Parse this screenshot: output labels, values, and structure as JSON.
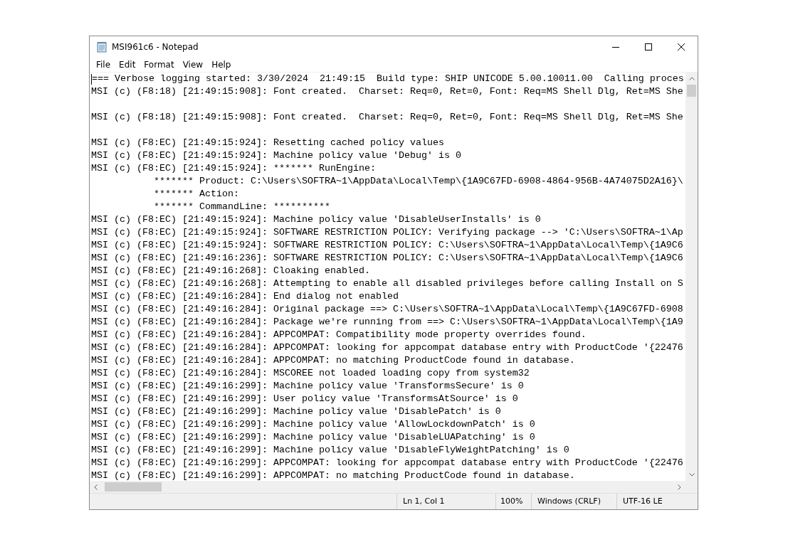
{
  "window": {
    "title": "MSI961c6 - Notepad"
  },
  "menu": [
    "File",
    "Edit",
    "Format",
    "View",
    "Help"
  ],
  "lines": [
    {
      "kind": "text",
      "text": "=== Verbose logging started: 3/30/2024  21:49:15  Build type: SHIP UNICODE 5.00.10011.00  Calling proces",
      "caret": true
    },
    {
      "kind": "text",
      "text": "MSI (c) (F8:18) [21:49:15:908]: Font created.  Charset: Req=0, Ret=0, Font: Req=MS Shell Dlg, Ret=MS She",
      "caret": false
    },
    {
      "kind": "blank"
    },
    {
      "kind": "text",
      "text": "MSI (c) (F8:18) [21:49:15:908]: Font created.  Charset: Req=0, Ret=0, Font: Req=MS Shell Dlg, Ret=MS She",
      "caret": false
    },
    {
      "kind": "blank"
    },
    {
      "kind": "text",
      "text": "MSI (c) (F8:EC) [21:49:15:924]: Resetting cached policy values",
      "caret": false
    },
    {
      "kind": "text",
      "text": "MSI (c) (F8:EC) [21:49:15:924]: Machine policy value 'Debug' is 0",
      "caret": false
    },
    {
      "kind": "text",
      "text": "MSI (c) (F8:EC) [21:49:15:924]: ******* RunEngine:",
      "caret": false
    },
    {
      "kind": "text",
      "text": "           ******* Product: C:\\Users\\SOFTRA~1\\AppData\\Local\\Temp\\{1A9C67FD-6908-4864-956B-4A74075D2A16}\\",
      "caret": false
    },
    {
      "kind": "text",
      "text": "           ******* Action: ",
      "caret": false
    },
    {
      "kind": "text",
      "text": "           ******* CommandLine: **********",
      "caret": false
    },
    {
      "kind": "text",
      "text": "MSI (c) (F8:EC) [21:49:15:924]: Machine policy value 'DisableUserInstalls' is 0",
      "caret": false
    },
    {
      "kind": "text",
      "text": "MSI (c) (F8:EC) [21:49:15:924]: SOFTWARE RESTRICTION POLICY: Verifying package --> 'C:\\Users\\SOFTRA~1\\Ap",
      "caret": false
    },
    {
      "kind": "text",
      "text": "MSI (c) (F8:EC) [21:49:15:924]: SOFTWARE RESTRICTION POLICY: C:\\Users\\SOFTRA~1\\AppData\\Local\\Temp\\{1A9C6",
      "caret": false
    },
    {
      "kind": "text",
      "text": "MSI (c) (F8:EC) [21:49:16:236]: SOFTWARE RESTRICTION POLICY: C:\\Users\\SOFTRA~1\\AppData\\Local\\Temp\\{1A9C6",
      "caret": false
    },
    {
      "kind": "text",
      "text": "MSI (c) (F8:EC) [21:49:16:268]: Cloaking enabled.",
      "caret": false
    },
    {
      "kind": "text",
      "text": "MSI (c) (F8:EC) [21:49:16:268]: Attempting to enable all disabled privileges before calling Install on S",
      "caret": false
    },
    {
      "kind": "text",
      "text": "MSI (c) (F8:EC) [21:49:16:284]: End dialog not enabled",
      "caret": false
    },
    {
      "kind": "text",
      "text": "MSI (c) (F8:EC) [21:49:16:284]: Original package ==> C:\\Users\\SOFTRA~1\\AppData\\Local\\Temp\\{1A9C67FD-6908",
      "caret": false
    },
    {
      "kind": "text",
      "text": "MSI (c) (F8:EC) [21:49:16:284]: Package we're running from ==> C:\\Users\\SOFTRA~1\\AppData\\Local\\Temp\\{1A9",
      "caret": false
    },
    {
      "kind": "text",
      "text": "MSI (c) (F8:EC) [21:49:16:284]: APPCOMPAT: Compatibility mode property overrides found.",
      "caret": false
    },
    {
      "kind": "text",
      "text": "MSI (c) (F8:EC) [21:49:16:284]: APPCOMPAT: looking for appcompat database entry with ProductCode '{22476",
      "caret": false
    },
    {
      "kind": "text",
      "text": "MSI (c) (F8:EC) [21:49:16:284]: APPCOMPAT: no matching ProductCode found in database.",
      "caret": false
    },
    {
      "kind": "text",
      "text": "MSI (c) (F8:EC) [21:49:16:284]: MSCOREE not loaded loading copy from system32",
      "caret": false
    },
    {
      "kind": "text",
      "text": "MSI (c) (F8:EC) [21:49:16:299]: Machine policy value 'TransformsSecure' is 0",
      "caret": false
    },
    {
      "kind": "text",
      "text": "MSI (c) (F8:EC) [21:49:16:299]: User policy value 'TransformsAtSource' is 0",
      "caret": false
    },
    {
      "kind": "text",
      "text": "MSI (c) (F8:EC) [21:49:16:299]: Machine policy value 'DisablePatch' is 0",
      "caret": false
    },
    {
      "kind": "text",
      "text": "MSI (c) (F8:EC) [21:49:16:299]: Machine policy value 'AllowLockdownPatch' is 0",
      "caret": false
    },
    {
      "kind": "text",
      "text": "MSI (c) (F8:EC) [21:49:16:299]: Machine policy value 'DisableLUAPatching' is 0",
      "caret": false
    },
    {
      "kind": "text",
      "text": "MSI (c) (F8:EC) [21:49:16:299]: Machine policy value 'DisableFlyWeightPatching' is 0",
      "caret": false
    },
    {
      "kind": "text",
      "text": "MSI (c) (F8:EC) [21:49:16:299]: APPCOMPAT: looking for appcompat database entry with ProductCode '{22476",
      "caret": false
    },
    {
      "kind": "text",
      "text": "MSI (c) (F8:EC) [21:49:16:299]: APPCOMPAT: no matching ProductCode found in database.",
      "caret": false
    }
  ],
  "status_bar": {
    "position": "Ln 1, Col 1",
    "zoom": "100%",
    "line_endings": "Windows (CRLF)",
    "encoding": "UTF-16 LE"
  }
}
